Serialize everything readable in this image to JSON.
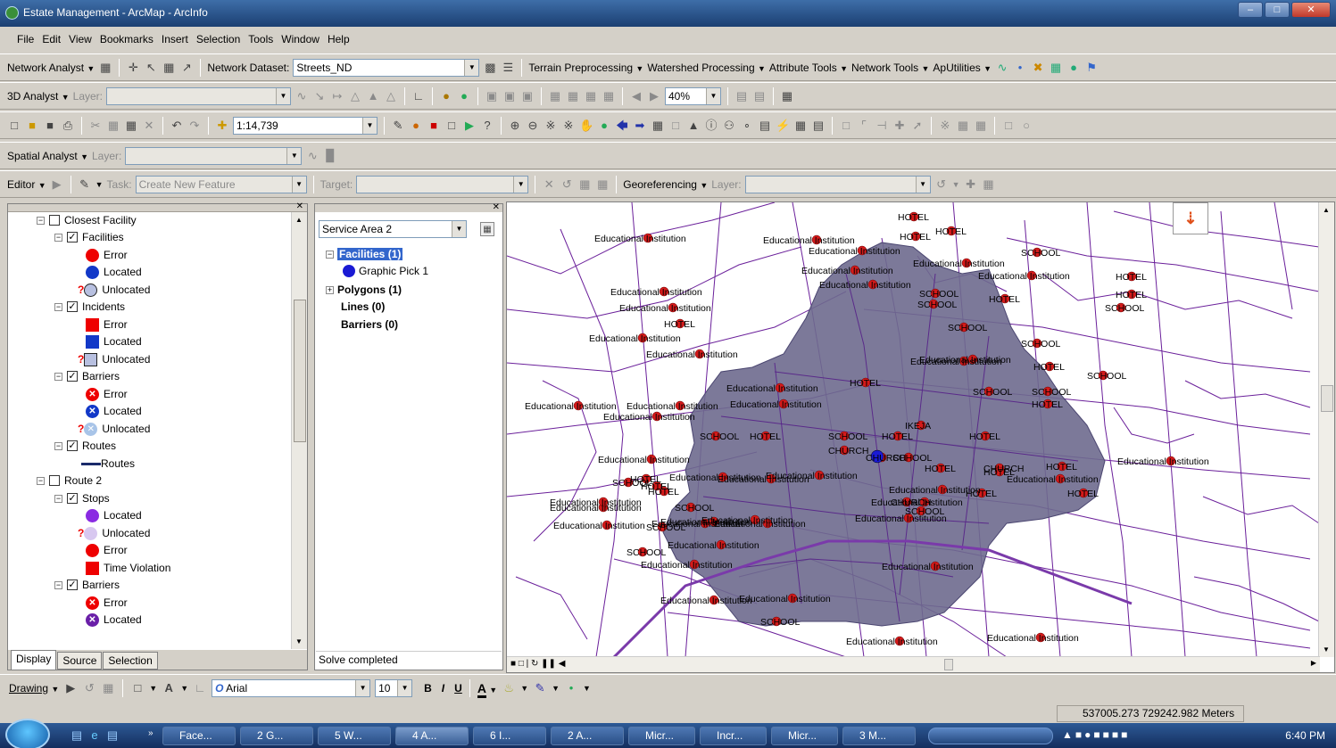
{
  "window": {
    "title": "Estate Management - ArcMap - ArcInfo"
  },
  "menu": [
    "File",
    "Edit",
    "View",
    "Bookmarks",
    "Insert",
    "Selection",
    "Tools",
    "Window",
    "Help"
  ],
  "toolbar1": {
    "network_analyst": "Network Analyst",
    "dataset_label": "Network Dataset:",
    "dataset_value": "Streets_ND",
    "terrain": "Terrain Preprocessing",
    "watershed": "Watershed Processing",
    "attribute": "Attribute Tools",
    "network_tools": "Network Tools",
    "aputilities": "ApUtilities"
  },
  "toolbar2": {
    "analyst": "3D Analyst",
    "layer_label": "Layer:",
    "zoom": "40%"
  },
  "toolbar3": {
    "scale": "1:14,739"
  },
  "toolbar4": {
    "analyst": "Spatial Analyst",
    "layer_label": "Layer:"
  },
  "toolbar5": {
    "editor": "Editor",
    "task_label": "Task:",
    "task_value": "Create New Feature",
    "target_label": "Target:",
    "georef": "Georeferencing",
    "layer_label": "Layer:"
  },
  "toc": {
    "items": [
      {
        "label": "Closest Facility"
      },
      {
        "label": "Facilities"
      },
      {
        "label": "Error"
      },
      {
        "label": "Located"
      },
      {
        "label": "Unlocated"
      },
      {
        "label": "Incidents"
      },
      {
        "label": "Error"
      },
      {
        "label": "Located"
      },
      {
        "label": "Unlocated"
      },
      {
        "label": "Barriers"
      },
      {
        "label": "Error"
      },
      {
        "label": "Located"
      },
      {
        "label": "Unlocated"
      },
      {
        "label": "Routes"
      },
      {
        "label": "Routes"
      },
      {
        "label": "Route 2"
      },
      {
        "label": "Stops"
      },
      {
        "label": "Located"
      },
      {
        "label": "Unlocated"
      },
      {
        "label": "Error"
      },
      {
        "label": "Time Violation"
      },
      {
        "label": "Barriers"
      },
      {
        "label": "Error"
      },
      {
        "label": "Located"
      }
    ],
    "tabs": [
      "Display",
      "Source",
      "Selection"
    ]
  },
  "na_window": {
    "combo": "Service Area 2",
    "facilities": "Facilities (1)",
    "graphic_pick": "Graphic Pick 1",
    "polygons": "Polygons (1)",
    "lines": "Lines (0)",
    "barriers": "Barriers (0)",
    "status": "Solve completed"
  },
  "map": {
    "labels": [
      {
        "t": "HOTEL"
      },
      {
        "t": "HOTEL"
      },
      {
        "t": "HOTEL"
      },
      {
        "t": "Educational Institution"
      },
      {
        "t": "Educational Institution"
      },
      {
        "t": "Educational Institution"
      },
      {
        "t": "SCHOOL"
      },
      {
        "t": "Educational Institution"
      },
      {
        "t": "Educational Institution"
      },
      {
        "t": "Educational Institution"
      },
      {
        "t": "HOTEL"
      },
      {
        "t": "Educational Institution"
      },
      {
        "t": "HOTEL"
      },
      {
        "t": "Educational Institution"
      },
      {
        "t": "SCHOOL"
      },
      {
        "t": "SCHOOL"
      },
      {
        "t": "HOTEL"
      },
      {
        "t": "SCHOOL"
      },
      {
        "t": "Educational Institution"
      },
      {
        "t": "HOTEL"
      },
      {
        "t": "SCHOOL"
      },
      {
        "t": "Educational Institution"
      },
      {
        "t": "Educational Institution"
      },
      {
        "t": "SCHOOL"
      },
      {
        "t": "Educational Institution"
      },
      {
        "t": "Educational Institution"
      },
      {
        "t": "HOTEL"
      },
      {
        "t": "HOTEL"
      },
      {
        "t": "SCHOOL"
      },
      {
        "t": "Educational Institution"
      },
      {
        "t": "SCHOOL"
      },
      {
        "t": "Educational Institution"
      },
      {
        "t": "SCHOOL"
      },
      {
        "t": "Educational Institution"
      },
      {
        "t": "HOTEL"
      },
      {
        "t": "Educational Institution"
      },
      {
        "t": "Educational Institution"
      },
      {
        "t": "SCHOOL"
      },
      {
        "t": "HOTEL"
      },
      {
        "t": "SCHOOL"
      },
      {
        "t": "HOTEL"
      },
      {
        "t": "IKEJA"
      },
      {
        "t": "HOTEL"
      },
      {
        "t": "SCHOOL"
      },
      {
        "t": "CHURCH"
      },
      {
        "t": "CHURCH"
      },
      {
        "t": "CHURCH"
      },
      {
        "t": "HOTEL"
      },
      {
        "t": "Educational Institution"
      },
      {
        "t": "HOTEL"
      },
      {
        "t": "HOTEL"
      },
      {
        "t": "Educational Institution"
      },
      {
        "t": "HOTEL"
      },
      {
        "t": "Educational Institution"
      },
      {
        "t": "Educational Institution"
      },
      {
        "t": "Educational Institution"
      },
      {
        "t": "HOTEL"
      },
      {
        "t": "CHURCH"
      },
      {
        "t": "HOTEL"
      },
      {
        "t": "Educational Institution"
      },
      {
        "t": "Educational Institution"
      },
      {
        "t": "Educational Institution"
      },
      {
        "t": "HOTEL"
      },
      {
        "t": "SCHOOL"
      },
      {
        "t": "Educational Institution"
      },
      {
        "t": "SCHOOL"
      },
      {
        "t": "Educational Institution"
      },
      {
        "t": "HOTEL"
      },
      {
        "t": "Educational Institution"
      },
      {
        "t": "Educational Institution"
      },
      {
        "t": "SCHOOL"
      },
      {
        "t": "Educational Institution"
      },
      {
        "t": "Educational Institution"
      },
      {
        "t": "SCHOOL"
      },
      {
        "t": "Educational Institution"
      },
      {
        "t": "Educational Institution"
      },
      {
        "t": "Educational Institution"
      },
      {
        "t": "Educational Institution"
      },
      {
        "t": "Educational Institution"
      },
      {
        "t": "SCHOOL"
      },
      {
        "t": "Educational Institution"
      },
      {
        "t": "Educational Institution"
      },
      {
        "t": "SCHOOL"
      },
      {
        "t": "Educational Institution"
      },
      {
        "t": "Educational Institution"
      }
    ]
  },
  "drawing": {
    "label": "Drawing",
    "font": "Arial",
    "size": "10",
    "bold": "B",
    "italic": "I",
    "underline": "U",
    "text": "A"
  },
  "status": {
    "coords": "537005.273  729242.982 Meters"
  },
  "taskbar": {
    "buttons": [
      "Face...",
      "2 G...",
      "5 W...",
      "4 A...",
      "6 I...",
      "2 A...",
      "Micr...",
      "Incr...",
      "Micr...",
      "3 M..."
    ],
    "clock": "6:40 PM"
  },
  "colors": {
    "service_area": "#6e6a8e",
    "streets": "#6a1f9a",
    "poi": "#d41a1a",
    "facility": "#1a1ad4"
  }
}
